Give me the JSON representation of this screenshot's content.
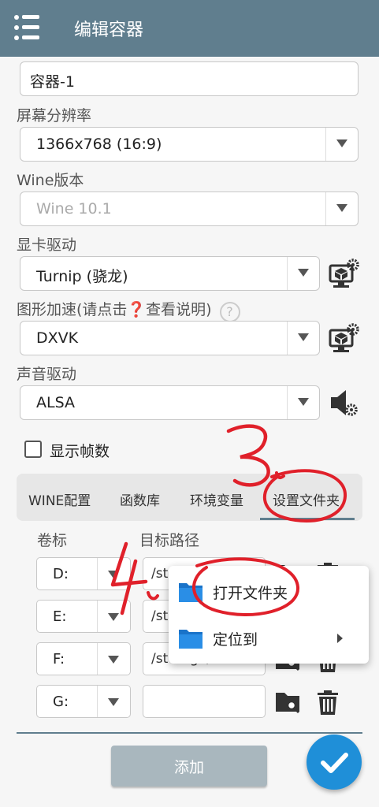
{
  "appbar": {
    "title": "编辑容器"
  },
  "container_name": "容器-1",
  "screen_resolution": {
    "label": "屏幕分辨率",
    "value": "1366x768 (16:9)"
  },
  "wine_version": {
    "label": "Wine版本",
    "value": "Wine 10.1"
  },
  "gpu_driver": {
    "label": "显卡驱动",
    "value": "Turnip (骁龙)"
  },
  "graphics_accel": {
    "label": "图形加速(请点击❓查看说明)",
    "help": "?",
    "value": "DXVK"
  },
  "audio_driver": {
    "label": "声音驱动",
    "value": "ALSA"
  },
  "show_fps": {
    "label": "显示帧数",
    "checked": false
  },
  "tabs": [
    "WINE配置",
    "函数库",
    "环境变量",
    "设置文件夹"
  ],
  "drives": {
    "col_volume": "卷标",
    "col_target": "目标路径",
    "rows": [
      {
        "letter": "D:",
        "path": "/st"
      },
      {
        "letter": "E:",
        "path": "/st"
      },
      {
        "letter": "F:",
        "path": "/storage/emul"
      },
      {
        "letter": "G:",
        "path": ""
      }
    ]
  },
  "popup_menu": {
    "items": [
      {
        "label": "打开文件夹"
      },
      {
        "label": "定位到"
      }
    ]
  },
  "add_button": "添加",
  "annotations": [
    "3.",
    "4."
  ],
  "colors": {
    "appbar": "#607e8e",
    "fab": "#1f8fd8",
    "annotation": "#e0202a"
  }
}
